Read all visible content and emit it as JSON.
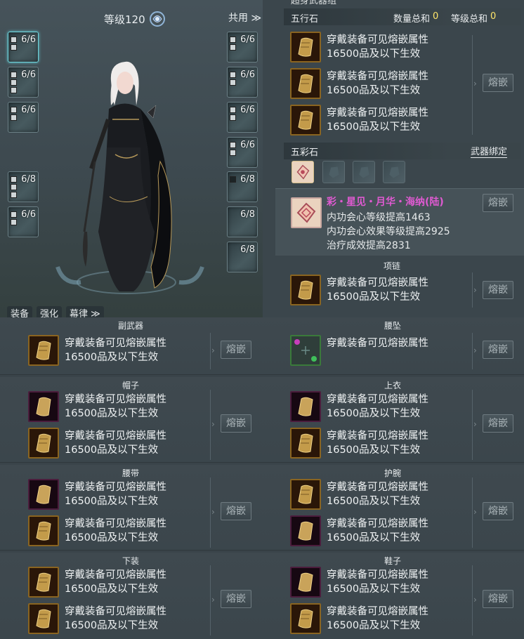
{
  "character": {
    "level_label": "等级120",
    "shared_label": "共用 ≫",
    "tabs": [
      "装备",
      "强化",
      "幕律 ≫"
    ],
    "left_slots": [
      "6/6",
      "6/6",
      "6/6",
      "6/8",
      "6/6"
    ],
    "right_slots": [
      "6/6",
      "6/6",
      "6/6",
      "6/6",
      "6/8",
      "6/8",
      "6/8"
    ]
  },
  "top_header": {
    "partial_label": "超身武器组"
  },
  "five_elements": {
    "title": "五行石",
    "count_label": "数量总和",
    "count_value": "0",
    "level_label": "等级总和",
    "level_value": "0",
    "lines": [
      {
        "line1": "穿戴装备可见熔嵌属性",
        "line2": "16500品及以下生效"
      },
      {
        "line1": "穿戴装备可见熔嵌属性",
        "line2": "16500品及以下生效"
      },
      {
        "line1": "穿戴装备可见熔嵌属性",
        "line2": "16500品及以下生效"
      }
    ],
    "button": "熔嵌"
  },
  "five_color": {
    "title": "五彩石",
    "bind_label": "武器绑定",
    "stone_name": "彩・星见・月华・海纳(陆)",
    "attrs": [
      "内功会心等级提高1463",
      "内功会心效果等级提高2925",
      "治疗成效提高2831"
    ],
    "button": "熔嵌"
  },
  "sections": [
    {
      "id": "necklace",
      "title": "项链",
      "rows": [
        {
          "line1": "穿戴装备可见熔嵌属性",
          "line2": "16500品及以下生效"
        }
      ],
      "button": "熔嵌"
    },
    {
      "id": "offhand",
      "title": "副武器",
      "rows": [
        {
          "line1": "穿戴装备可见熔嵌属性",
          "line2": "16500品及以下生效"
        }
      ],
      "button": "熔嵌"
    },
    {
      "id": "waist-pendant",
      "title": "腰坠",
      "rows": [
        {
          "line1": "穿戴装备可见熔嵌属性",
          "line2": ""
        }
      ],
      "button": "熔嵌"
    },
    {
      "id": "hat",
      "title": "帽子",
      "rows": [
        {
          "line1": "穿戴装备可见熔嵌属性",
          "line2": "16500品及以下生效"
        },
        {
          "line1": "穿戴装备可见熔嵌属性",
          "line2": "16500品及以下生效"
        }
      ],
      "button": "熔嵌"
    },
    {
      "id": "top",
      "title": "上衣",
      "rows": [
        {
          "line1": "穿戴装备可见熔嵌属性",
          "line2": "16500品及以下生效"
        },
        {
          "line1": "穿戴装备可见熔嵌属性",
          "line2": "16500品及以下生效"
        }
      ],
      "button": "熔嵌"
    },
    {
      "id": "belt",
      "title": "腰带",
      "rows": [
        {
          "line1": "穿戴装备可见熔嵌属性",
          "line2": "16500品及以下生效"
        },
        {
          "line1": "穿戴装备可见熔嵌属性",
          "line2": "16500品及以下生效"
        }
      ],
      "button": "熔嵌"
    },
    {
      "id": "bracers",
      "title": "护腕",
      "rows": [
        {
          "line1": "穿戴装备可见熔嵌属性",
          "line2": "16500品及以下生效"
        },
        {
          "line1": "穿戴装备可见熔嵌属性",
          "line2": "16500品及以下生效"
        }
      ],
      "button": "熔嵌"
    },
    {
      "id": "pants",
      "title": "下装",
      "rows": [
        {
          "line1": "穿戴装备可见熔嵌属性",
          "line2": "16500品及以下生效"
        },
        {
          "line1": "穿戴装备可见熔嵌属性",
          "line2": "16500品及以下生效"
        }
      ],
      "button": "熔嵌"
    },
    {
      "id": "shoes",
      "title": "鞋子",
      "rows": [
        {
          "line1": "穿戴装备可见熔嵌属性",
          "line2": "16500品及以下生效"
        },
        {
          "line1": "穿戴装备可见熔嵌属性",
          "line2": "16500品及以下生效"
        }
      ],
      "button": "熔嵌"
    }
  ]
}
